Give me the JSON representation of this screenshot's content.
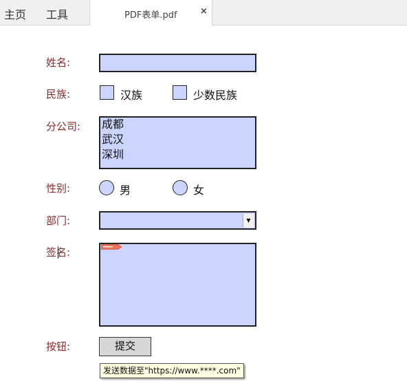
{
  "nav": {
    "home": "主页",
    "tools": "工具"
  },
  "tab": {
    "title": "PDF表单.pdf",
    "close": "×"
  },
  "form": {
    "name_label": "姓名:",
    "ethnicity_label": "民族:",
    "ethnicity_options": [
      "汉族",
      "少数民族"
    ],
    "branch_label": "分公司:",
    "branch_items": [
      "成都",
      "武汉",
      "深圳"
    ],
    "gender_label": "性别:",
    "gender_options": [
      "男",
      "女"
    ],
    "dept_label": "部门:",
    "dept_arrow": "▼",
    "signature_label": "签名:",
    "button_label": "按钮:",
    "submit_text": "提交",
    "tooltip": "发送数据至\"https://www.****.com\""
  },
  "colors": {
    "field_bg": "#ccd5ff",
    "label_color": "#8b2a2a",
    "badge_color": "#e8735a"
  },
  "icons": {
    "close": "close-icon",
    "dropdown": "chevron-down-icon",
    "signature": "signature-flag-icon"
  }
}
